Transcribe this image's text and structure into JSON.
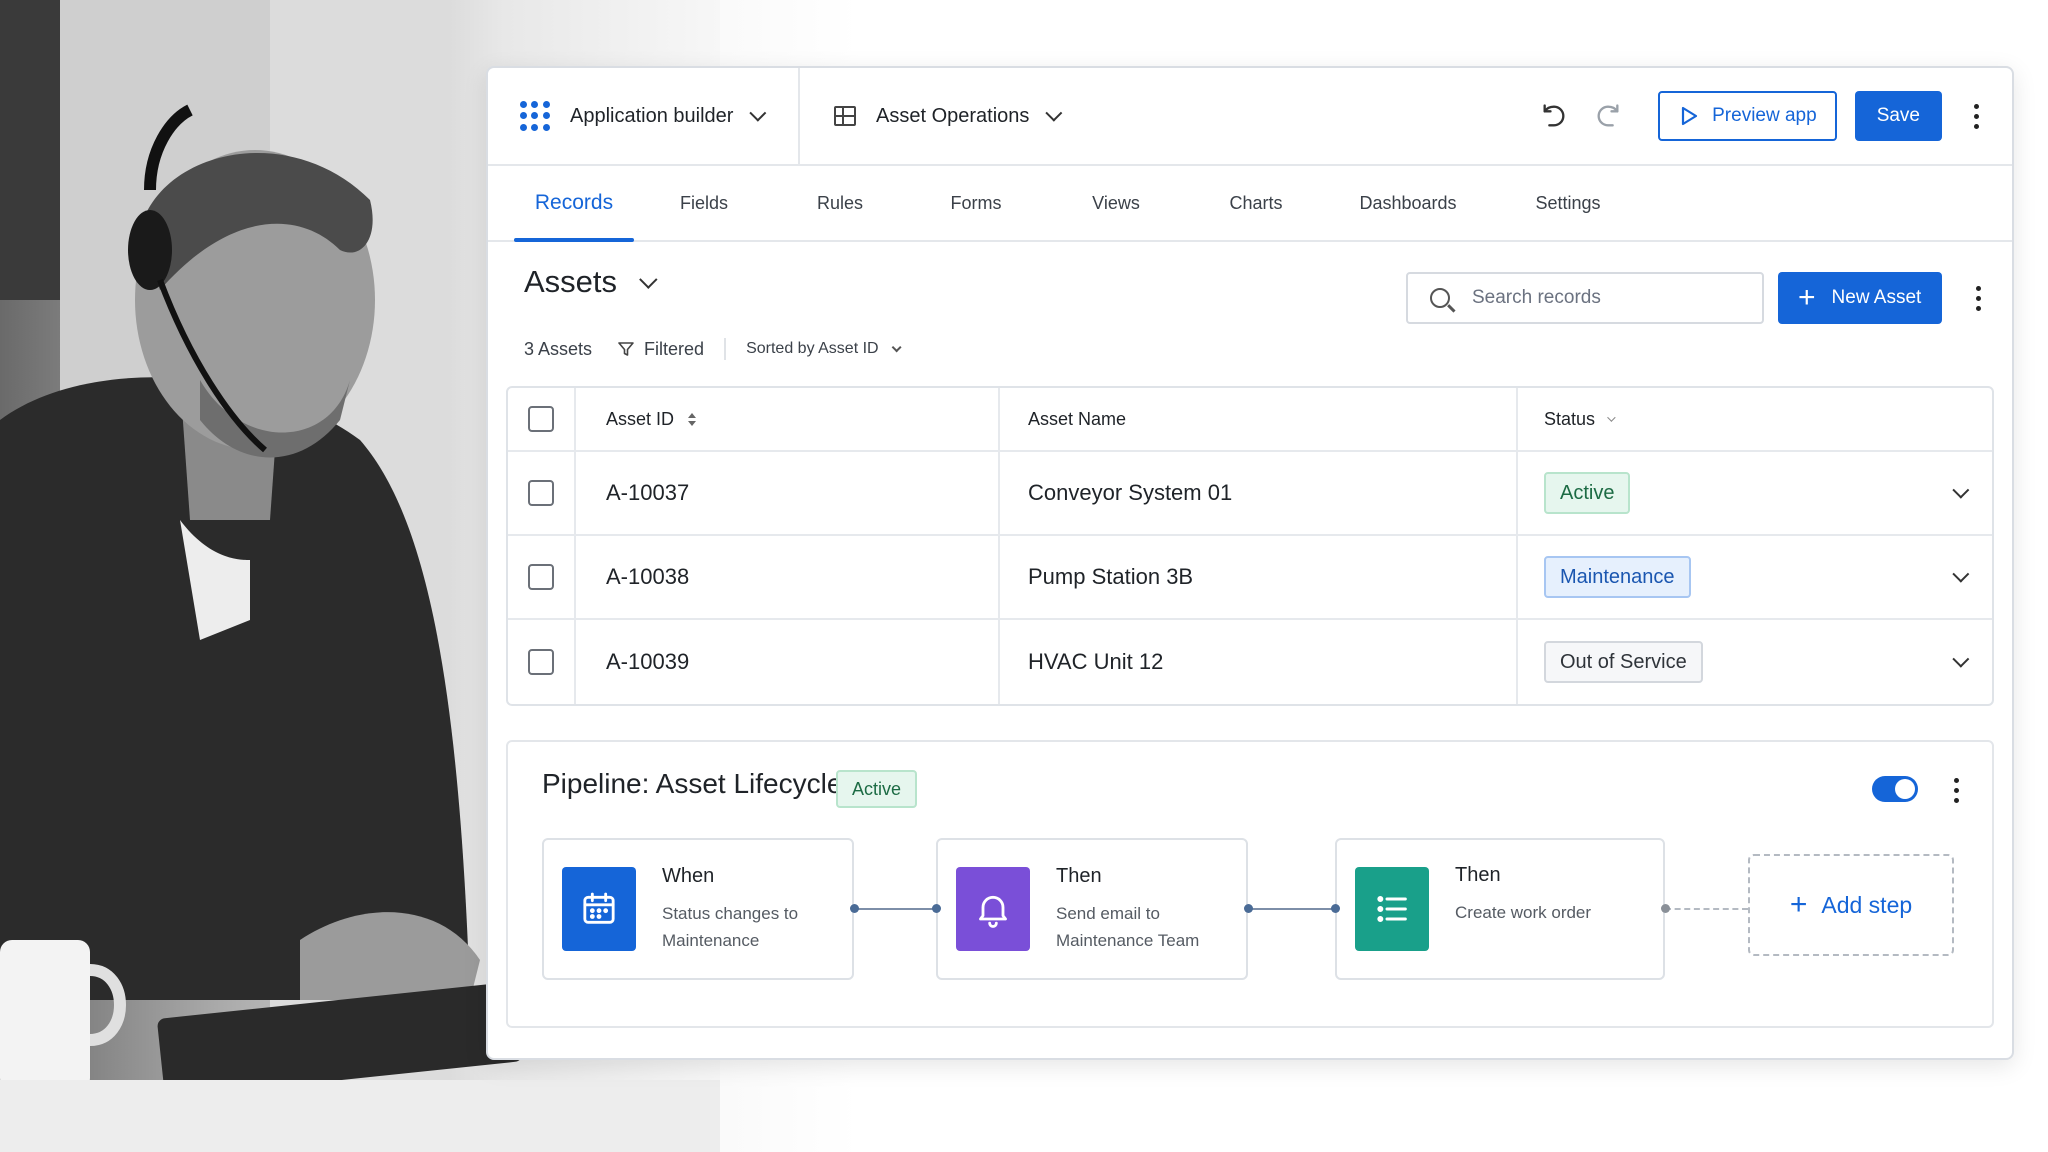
{
  "header": {
    "app_switcher_label": "Application builder",
    "app_name": "Asset Operations",
    "preview_label": "Preview app",
    "save_label": "Save"
  },
  "tabs": [
    {
      "label": "Records",
      "active": true
    },
    {
      "label": "Fields"
    },
    {
      "label": "Rules"
    },
    {
      "label": "Forms"
    },
    {
      "label": "Views"
    },
    {
      "label": "Charts"
    },
    {
      "label": "Dashboards"
    },
    {
      "label": "Settings"
    }
  ],
  "section": {
    "title": "Assets",
    "search_placeholder": "Search records",
    "new_button": "New Asset",
    "count": "3 Assets",
    "filtered": "Filtered",
    "sorted": "Sorted by Asset ID"
  },
  "table": {
    "columns": [
      "Asset ID",
      "Asset Name",
      "Status"
    ],
    "rows": [
      {
        "id": "A-10037",
        "name": "Conveyor System 01",
        "status": "Active",
        "status_tone": "green"
      },
      {
        "id": "A-10038",
        "name": "Pump Station 3B",
        "status": "Maintenance",
        "status_tone": "blue"
      },
      {
        "id": "A-10039",
        "name": "HVAC Unit 12",
        "status": "Out of Service",
        "status_tone": "gray"
      }
    ]
  },
  "pipeline": {
    "title": "Pipeline: Asset Lifecycle",
    "badge": "Active",
    "enabled": true,
    "steps": [
      {
        "kind": "When",
        "line1": "Status changes to",
        "line2": "Maintenance",
        "icon": "calendar-icon",
        "color": "#1565d8"
      },
      {
        "kind": "Then",
        "line1": "Send email to",
        "line2": "Maintenance Team",
        "icon": "bell-icon",
        "color": "#7a4fd8"
      },
      {
        "kind": "Then",
        "line1": "Create work order",
        "line2": "",
        "icon": "list-icon",
        "color": "#19a08a"
      }
    ],
    "add_step_label": "Add step"
  },
  "colors": {
    "accent": "#1565d8",
    "active_green": "#1c6b44",
    "maintenance_blue": "#1a56b0"
  }
}
